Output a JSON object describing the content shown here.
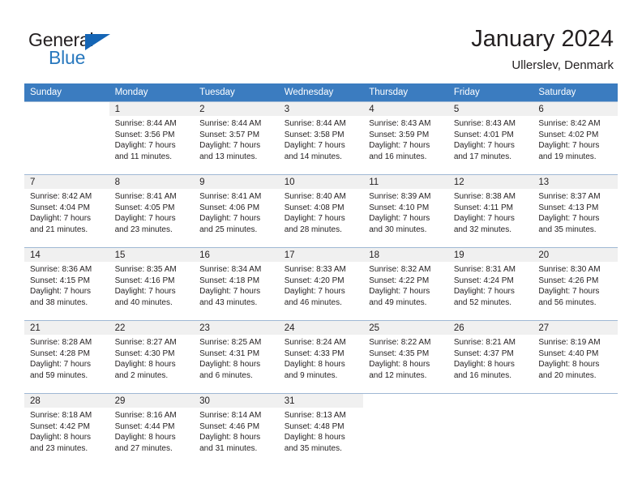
{
  "logo": {
    "word1": "General",
    "word2": "Blue",
    "triangle_color": "#1565b5",
    "word2_color": "#2878be"
  },
  "header": {
    "title": "January 2024",
    "subtitle": "Ullerslev, Denmark"
  },
  "colors": {
    "header_row_bg": "#3b7cc0",
    "header_row_text": "#ffffff",
    "daynum_band_bg": "#f0f0f0",
    "cell_border": "#9fb8d4",
    "text": "#231f20"
  },
  "weekdays": [
    "Sunday",
    "Monday",
    "Tuesday",
    "Wednesday",
    "Thursday",
    "Friday",
    "Saturday"
  ],
  "weeks": [
    [
      {
        "day": "",
        "lines": []
      },
      {
        "day": "1",
        "lines": [
          "Sunrise: 8:44 AM",
          "Sunset: 3:56 PM",
          "Daylight: 7 hours",
          "and 11 minutes."
        ]
      },
      {
        "day": "2",
        "lines": [
          "Sunrise: 8:44 AM",
          "Sunset: 3:57 PM",
          "Daylight: 7 hours",
          "and 13 minutes."
        ]
      },
      {
        "day": "3",
        "lines": [
          "Sunrise: 8:44 AM",
          "Sunset: 3:58 PM",
          "Daylight: 7 hours",
          "and 14 minutes."
        ]
      },
      {
        "day": "4",
        "lines": [
          "Sunrise: 8:43 AM",
          "Sunset: 3:59 PM",
          "Daylight: 7 hours",
          "and 16 minutes."
        ]
      },
      {
        "day": "5",
        "lines": [
          "Sunrise: 8:43 AM",
          "Sunset: 4:01 PM",
          "Daylight: 7 hours",
          "and 17 minutes."
        ]
      },
      {
        "day": "6",
        "lines": [
          "Sunrise: 8:42 AM",
          "Sunset: 4:02 PM",
          "Daylight: 7 hours",
          "and 19 minutes."
        ]
      }
    ],
    [
      {
        "day": "7",
        "lines": [
          "Sunrise: 8:42 AM",
          "Sunset: 4:04 PM",
          "Daylight: 7 hours",
          "and 21 minutes."
        ]
      },
      {
        "day": "8",
        "lines": [
          "Sunrise: 8:41 AM",
          "Sunset: 4:05 PM",
          "Daylight: 7 hours",
          "and 23 minutes."
        ]
      },
      {
        "day": "9",
        "lines": [
          "Sunrise: 8:41 AM",
          "Sunset: 4:06 PM",
          "Daylight: 7 hours",
          "and 25 minutes."
        ]
      },
      {
        "day": "10",
        "lines": [
          "Sunrise: 8:40 AM",
          "Sunset: 4:08 PM",
          "Daylight: 7 hours",
          "and 28 minutes."
        ]
      },
      {
        "day": "11",
        "lines": [
          "Sunrise: 8:39 AM",
          "Sunset: 4:10 PM",
          "Daylight: 7 hours",
          "and 30 minutes."
        ]
      },
      {
        "day": "12",
        "lines": [
          "Sunrise: 8:38 AM",
          "Sunset: 4:11 PM",
          "Daylight: 7 hours",
          "and 32 minutes."
        ]
      },
      {
        "day": "13",
        "lines": [
          "Sunrise: 8:37 AM",
          "Sunset: 4:13 PM",
          "Daylight: 7 hours",
          "and 35 minutes."
        ]
      }
    ],
    [
      {
        "day": "14",
        "lines": [
          "Sunrise: 8:36 AM",
          "Sunset: 4:15 PM",
          "Daylight: 7 hours",
          "and 38 minutes."
        ]
      },
      {
        "day": "15",
        "lines": [
          "Sunrise: 8:35 AM",
          "Sunset: 4:16 PM",
          "Daylight: 7 hours",
          "and 40 minutes."
        ]
      },
      {
        "day": "16",
        "lines": [
          "Sunrise: 8:34 AM",
          "Sunset: 4:18 PM",
          "Daylight: 7 hours",
          "and 43 minutes."
        ]
      },
      {
        "day": "17",
        "lines": [
          "Sunrise: 8:33 AM",
          "Sunset: 4:20 PM",
          "Daylight: 7 hours",
          "and 46 minutes."
        ]
      },
      {
        "day": "18",
        "lines": [
          "Sunrise: 8:32 AM",
          "Sunset: 4:22 PM",
          "Daylight: 7 hours",
          "and 49 minutes."
        ]
      },
      {
        "day": "19",
        "lines": [
          "Sunrise: 8:31 AM",
          "Sunset: 4:24 PM",
          "Daylight: 7 hours",
          "and 52 minutes."
        ]
      },
      {
        "day": "20",
        "lines": [
          "Sunrise: 8:30 AM",
          "Sunset: 4:26 PM",
          "Daylight: 7 hours",
          "and 56 minutes."
        ]
      }
    ],
    [
      {
        "day": "21",
        "lines": [
          "Sunrise: 8:28 AM",
          "Sunset: 4:28 PM",
          "Daylight: 7 hours",
          "and 59 minutes."
        ]
      },
      {
        "day": "22",
        "lines": [
          "Sunrise: 8:27 AM",
          "Sunset: 4:30 PM",
          "Daylight: 8 hours",
          "and 2 minutes."
        ]
      },
      {
        "day": "23",
        "lines": [
          "Sunrise: 8:25 AM",
          "Sunset: 4:31 PM",
          "Daylight: 8 hours",
          "and 6 minutes."
        ]
      },
      {
        "day": "24",
        "lines": [
          "Sunrise: 8:24 AM",
          "Sunset: 4:33 PM",
          "Daylight: 8 hours",
          "and 9 minutes."
        ]
      },
      {
        "day": "25",
        "lines": [
          "Sunrise: 8:22 AM",
          "Sunset: 4:35 PM",
          "Daylight: 8 hours",
          "and 12 minutes."
        ]
      },
      {
        "day": "26",
        "lines": [
          "Sunrise: 8:21 AM",
          "Sunset: 4:37 PM",
          "Daylight: 8 hours",
          "and 16 minutes."
        ]
      },
      {
        "day": "27",
        "lines": [
          "Sunrise: 8:19 AM",
          "Sunset: 4:40 PM",
          "Daylight: 8 hours",
          "and 20 minutes."
        ]
      }
    ],
    [
      {
        "day": "28",
        "lines": [
          "Sunrise: 8:18 AM",
          "Sunset: 4:42 PM",
          "Daylight: 8 hours",
          "and 23 minutes."
        ]
      },
      {
        "day": "29",
        "lines": [
          "Sunrise: 8:16 AM",
          "Sunset: 4:44 PM",
          "Daylight: 8 hours",
          "and 27 minutes."
        ]
      },
      {
        "day": "30",
        "lines": [
          "Sunrise: 8:14 AM",
          "Sunset: 4:46 PM",
          "Daylight: 8 hours",
          "and 31 minutes."
        ]
      },
      {
        "day": "31",
        "lines": [
          "Sunrise: 8:13 AM",
          "Sunset: 4:48 PM",
          "Daylight: 8 hours",
          "and 35 minutes."
        ]
      },
      {
        "day": "",
        "lines": []
      },
      {
        "day": "",
        "lines": []
      },
      {
        "day": "",
        "lines": []
      }
    ]
  ]
}
